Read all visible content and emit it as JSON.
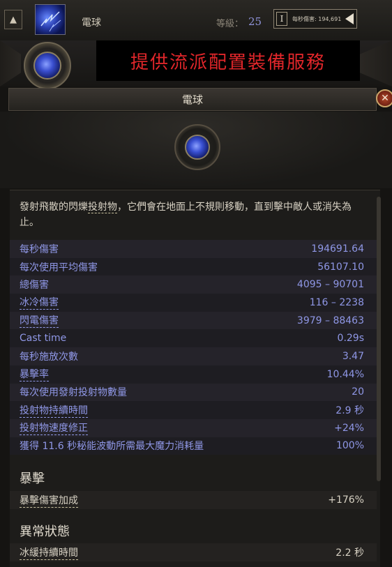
{
  "topbar": {
    "skill_name": "電球",
    "level_label": "等級：",
    "level_value": "25",
    "dps_tab": "I",
    "dps_text": "每秒傷害: 194,691"
  },
  "promo": {
    "text": "提供流派配置裝備服務"
  },
  "title": {
    "text": "電球",
    "close": "✕"
  },
  "description": {
    "part1": "發射飛散的閃爍",
    "keyword": "投射物",
    "part2": "，它們會在地面上不規則移動，直到擊中敵人或消失為止。"
  },
  "stats": [
    {
      "label": "每秒傷害",
      "value": "194691.64",
      "dashed": false
    },
    {
      "label": "每次使用平均傷害",
      "value": "56107.10",
      "dashed": false
    },
    {
      "label": "總傷害",
      "value": "4095 – 90701",
      "dashed": false
    },
    {
      "label": "冰冷傷害",
      "value": "116 – 2238",
      "dashed": true
    },
    {
      "label": "閃電傷害",
      "value": "3979 – 88463",
      "dashed": true
    },
    {
      "label": "Cast time",
      "value": "0.29s",
      "dashed": false
    },
    {
      "label": "每秒施放次數",
      "value": "3.47",
      "dashed": false
    },
    {
      "label": "暴擊率",
      "value": "10.44%",
      "dashed": true
    },
    {
      "label": "每次使用發射投射物數量",
      "value": "20",
      "dashed": false
    },
    {
      "label": "投射物持續時間",
      "value": "2.9 秒",
      "dashed": true
    },
    {
      "label": "投射物速度修正",
      "value": "+24%",
      "dashed": true
    },
    {
      "label": "獲得 11.6 秒秘能波動所需最大魔力消耗量",
      "value": "100%",
      "dashed": false
    }
  ],
  "crit_section": {
    "title": "暴擊",
    "label": "暴擊傷害加成",
    "value": "+176%"
  },
  "ailment_section": {
    "title": "異常狀態",
    "label": "冰緩持續時間",
    "value": "2.2 秒"
  },
  "colors": {
    "stat_blue": "#8f97e6",
    "promo_red": "#e0262a",
    "panel_bg": "#1d1c1a"
  },
  "icons": [
    "collapse-arrow-icon",
    "lightning-orb-icon",
    "close-icon",
    "back-arrow-icon"
  ]
}
